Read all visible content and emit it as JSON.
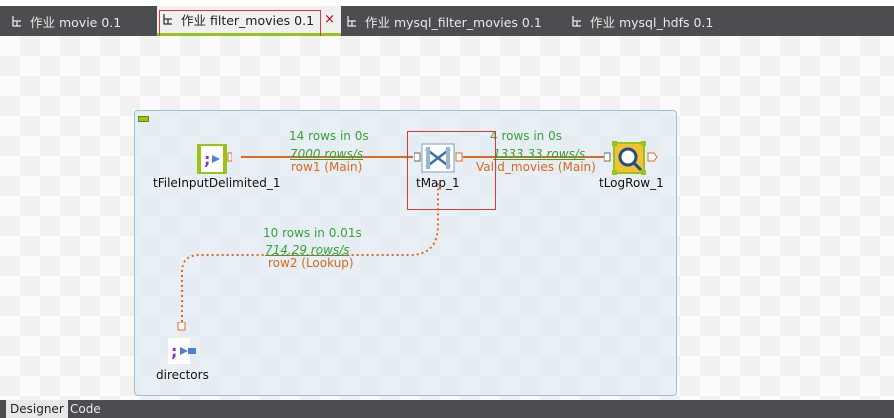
{
  "tabs": [
    {
      "label": "作业 movie 0.1",
      "active": false
    },
    {
      "label": "作业 filter_movies 0.1",
      "active": true
    },
    {
      "label": "作业 mysql_filter_movies 0.1",
      "active": false
    },
    {
      "label": "作业 mysql_hdfs 0.1",
      "active": false
    }
  ],
  "close_glyph": "×",
  "components": {
    "input": {
      "label": "tFileInputDelimited_1",
      "icon": "file-input-delimited-icon"
    },
    "map": {
      "label": "tMap_1",
      "icon": "tmap-icon"
    },
    "log": {
      "label": "tLogRow_1",
      "icon": "logrow-icon"
    },
    "directors": {
      "label": "directors",
      "icon": "file-input-delimited-icon"
    }
  },
  "links": {
    "row1": {
      "stat1": "14 rows in 0s",
      "stat2": "7000 rows/s",
      "name": "row1 (Main)"
    },
    "valid": {
      "stat1": "4 rows in 0s",
      "stat2": "1333.33 rows/s",
      "name": "Valid_movies (Main)"
    },
    "row2": {
      "stat1": "10 rows in 0.01s",
      "stat2": "714.29 rows/s",
      "name": "row2 (Lookup)"
    }
  },
  "bottom_tabs": [
    {
      "label": "Designer",
      "active": true
    },
    {
      "label": "Code",
      "active": false
    }
  ],
  "colors": {
    "main_link": "#e2691c",
    "stats_green": "#3aa13a",
    "accent": "#9bc21a",
    "selection": "#d93a3a"
  }
}
